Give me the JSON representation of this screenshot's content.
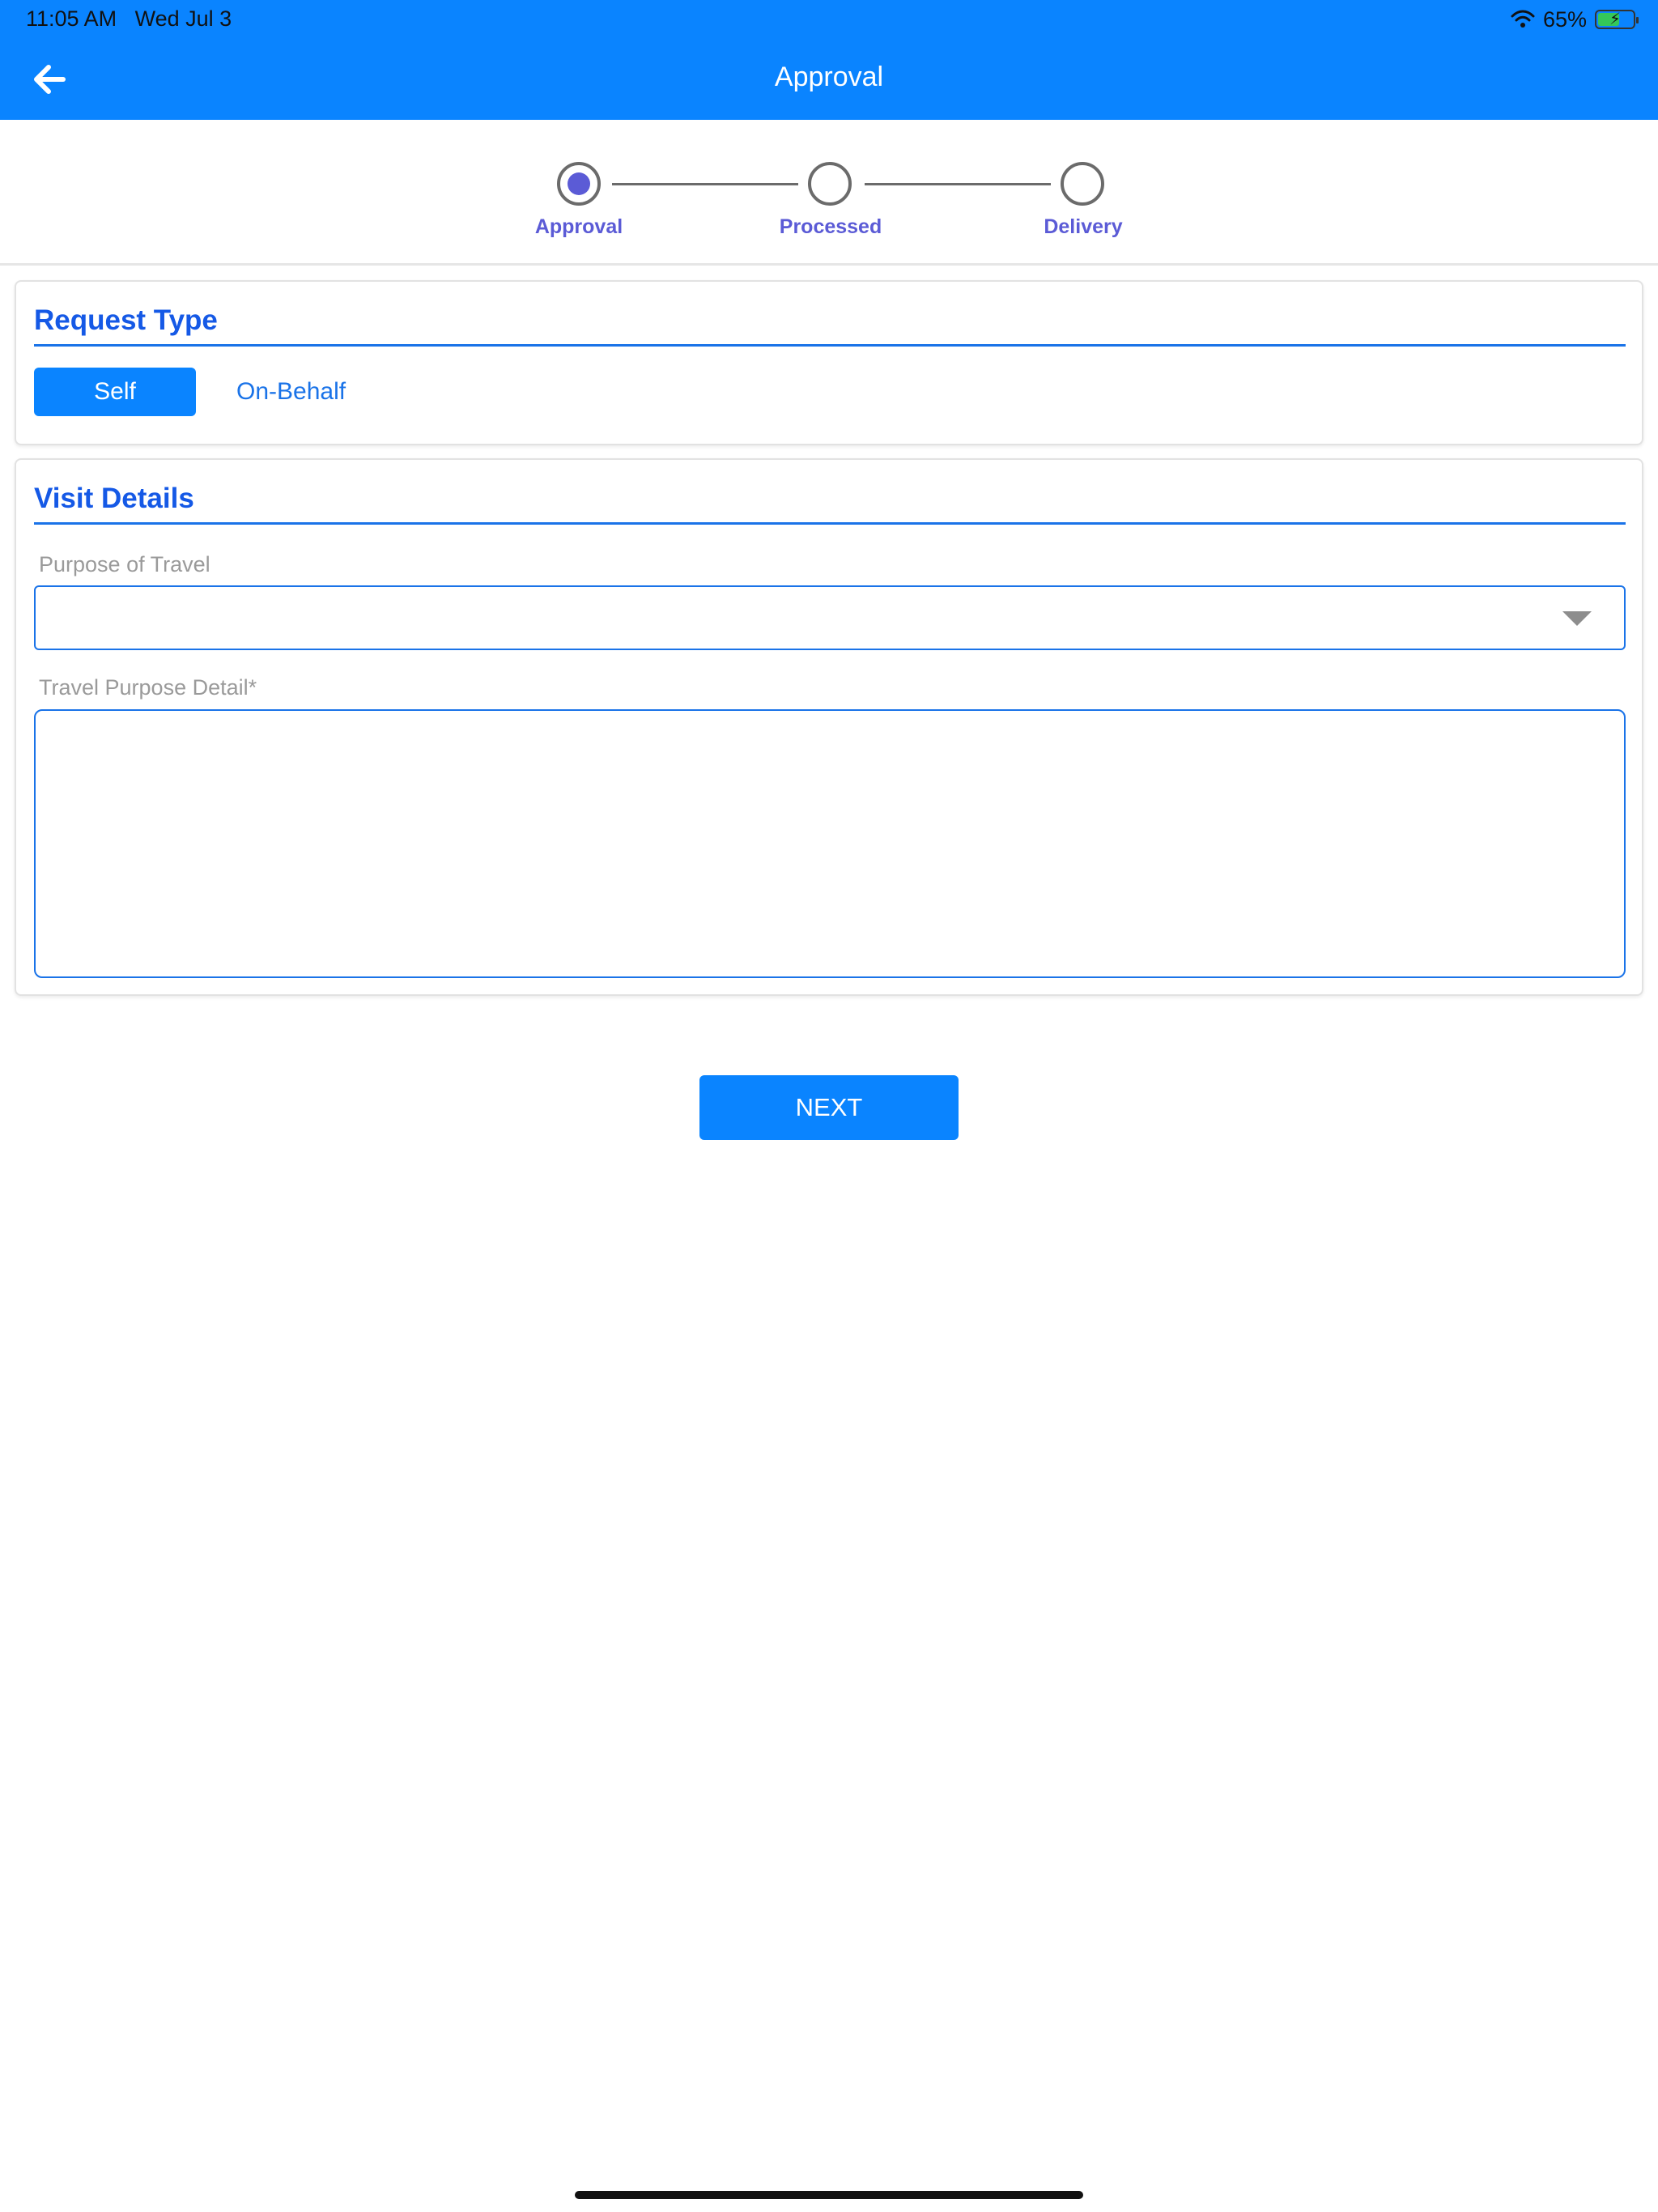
{
  "status_bar": {
    "time": "11:05 AM",
    "date": "Wed Jul 3",
    "battery_percent": "65%",
    "battery_level": 0.65
  },
  "nav": {
    "title": "Approval",
    "back_icon": "arrow-left-icon"
  },
  "stepper": {
    "steps": [
      {
        "label": "Approval",
        "active": true
      },
      {
        "label": "Processed",
        "active": false
      },
      {
        "label": "Delivery",
        "active": false
      }
    ]
  },
  "request_type": {
    "title": "Request Type",
    "options": [
      "Self",
      "On-Behalf"
    ],
    "selected": "Self"
  },
  "visit_details": {
    "title": "Visit Details",
    "purpose_label": "Purpose of Travel",
    "purpose_value": "",
    "detail_label": "Travel Purpose Detail*",
    "detail_value": ""
  },
  "actions": {
    "next_label": "NEXT"
  },
  "colors": {
    "primary": "#0a84ff",
    "title_blue": "#1559e6",
    "step_active": "#5b5bd6"
  }
}
